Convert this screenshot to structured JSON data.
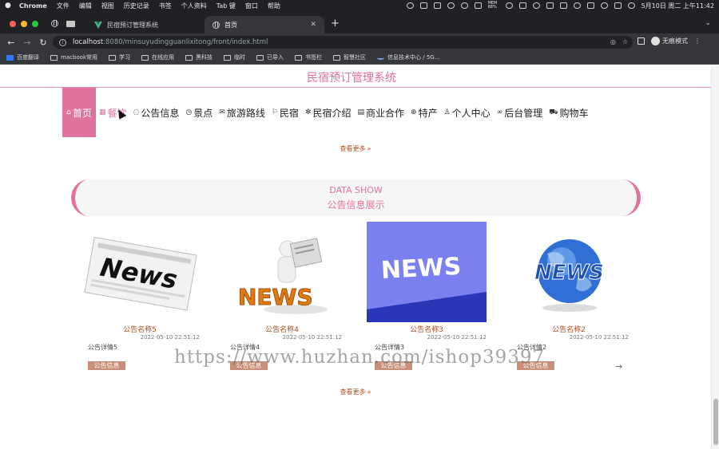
{
  "macos_menubar": {
    "app": "Chrome",
    "items": [
      "文件",
      "编辑",
      "视图",
      "历史记录",
      "书签",
      "个人资料",
      "Tab 键",
      "窗口",
      "帮助"
    ],
    "mem": "MEM 88%",
    "clock": "5月10日 周二 上午11:42"
  },
  "browser": {
    "tabs": [
      {
        "title": "民宿预订管理系统"
      },
      {
        "title": "首页",
        "active": true
      }
    ],
    "url_host": "localhost",
    "url_path": ":8080/minsuyudingguanlixitong/front/index.html",
    "incognito_label": "无痕模式",
    "bookmarks": [
      "百度翻译",
      "macbook常用",
      "学习",
      "在线应用",
      "黑科技",
      "临时",
      "已导入",
      "书签栏",
      "智慧社区",
      "信息技术中心 / 5G..."
    ]
  },
  "site": {
    "title": "民宿预订管理系统",
    "nav": [
      {
        "label": "首页",
        "icon": "home-icon",
        "glyph": "⌂"
      },
      {
        "label": "餐饮",
        "icon": "grid-icon",
        "glyph": "▦"
      },
      {
        "label": "公告信息",
        "icon": "info-icon",
        "glyph": "◌"
      },
      {
        "label": "景点",
        "icon": "clock-icon",
        "glyph": "◷"
      },
      {
        "label": "旅游路线",
        "icon": "mail-icon",
        "glyph": "✉"
      },
      {
        "label": "民宿",
        "icon": "flag-icon",
        "glyph": "⚐"
      },
      {
        "label": "民宿介绍",
        "icon": "sun-icon",
        "glyph": "✻"
      },
      {
        "label": "商业合作",
        "icon": "calendar-icon",
        "glyph": "▤"
      },
      {
        "label": "特产",
        "icon": "globe-icon",
        "glyph": "⊕"
      },
      {
        "label": "个人中心",
        "icon": "user-icon",
        "glyph": "♙"
      },
      {
        "label": "后台管理",
        "icon": "link-icon",
        "glyph": "∞"
      },
      {
        "label": "购物车",
        "icon": "cart-icon",
        "glyph": "⛟"
      }
    ],
    "more_label": "查看更多",
    "section": {
      "en": "DATA SHOW",
      "cn": "公告信息展示"
    },
    "news": [
      {
        "name": "公告名称5",
        "date": "2022-05-10 22:51:12",
        "detail": "公告详情5",
        "badge": "公告信息"
      },
      {
        "name": "公告名称4",
        "date": "2022-05-10 22:51:12",
        "detail": "公告详情4",
        "badge": "公告信息"
      },
      {
        "name": "公告名称3",
        "date": "2022-05-10 22:51:12",
        "detail": "公告详情3",
        "badge": "公告信息"
      },
      {
        "name": "公告名称2",
        "date": "2022-05-10 22:51:12",
        "detail": "公告详情2",
        "badge": "公告信息"
      }
    ],
    "watermark": "https://www.huzhan.com/ishop39397"
  },
  "colors": {
    "accent": "#e0739d",
    "title": "#e16f9a",
    "link": "#b24a1c",
    "badge": "#c89078"
  }
}
